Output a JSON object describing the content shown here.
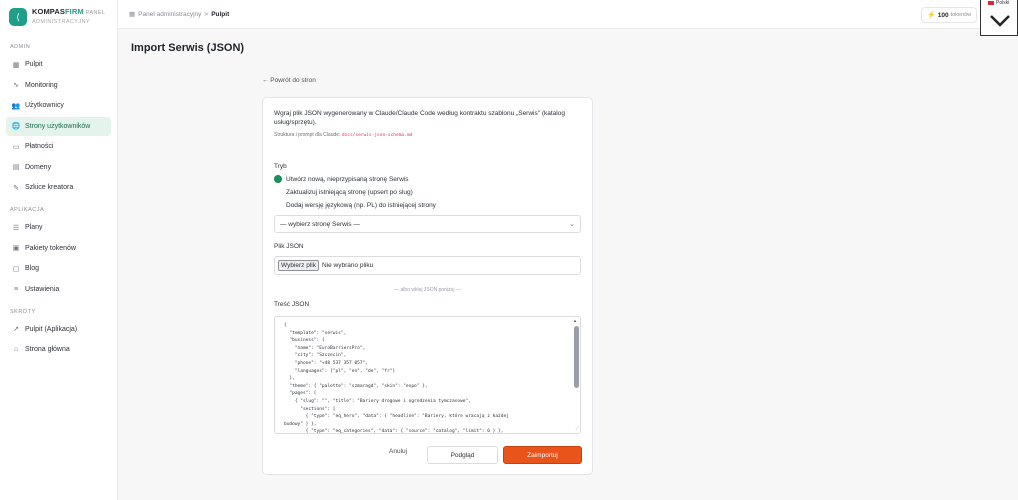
{
  "brand": {
    "name_part1": "KOMPAS",
    "name_part2": "FIRM",
    "panel_word": "PANEL",
    "subtitle": "ADMINISTRACYJNY",
    "logo_glyph": "⟨"
  },
  "sidebar": {
    "sections": [
      {
        "label": "ADMIN",
        "items": [
          {
            "label": "Pulpit",
            "icon": "dashboard-icon",
            "glyph": "▦"
          },
          {
            "label": "Monitoring",
            "icon": "activity-icon",
            "glyph": "∿"
          },
          {
            "label": "Użytkownicy",
            "icon": "users-icon",
            "glyph": "👥"
          },
          {
            "label": "Strony użytkowników",
            "icon": "globe-icon",
            "glyph": "🌐",
            "active": true
          },
          {
            "label": "Płatności",
            "icon": "card-icon",
            "glyph": "▭"
          },
          {
            "label": "Domeny",
            "icon": "server-icon",
            "glyph": "▤"
          },
          {
            "label": "Szkice kreatora",
            "icon": "edit-icon",
            "glyph": "✎"
          }
        ]
      },
      {
        "label": "APLIKACJA",
        "items": [
          {
            "label": "Plany",
            "icon": "list-icon",
            "glyph": "☰"
          },
          {
            "label": "Pakiety tokenów",
            "icon": "package-icon",
            "glyph": "▣"
          },
          {
            "label": "Blog",
            "icon": "document-icon",
            "glyph": "▢"
          },
          {
            "label": "Ustawienia",
            "icon": "settings-icon",
            "glyph": "≡"
          }
        ]
      },
      {
        "label": "SKRÓTY",
        "items": [
          {
            "label": "Pulpit (Aplikacja)",
            "icon": "external-link-icon",
            "glyph": "↗"
          },
          {
            "label": "Strona główna",
            "icon": "home-icon",
            "glyph": "⌂"
          }
        ]
      }
    ]
  },
  "topbar": {
    "breadcrumb_root": "Panel administracyjny",
    "breadcrumb_sep": ">",
    "breadcrumb_current": "Pulpit",
    "tokens_count": "100",
    "tokens_unit": "tokenów",
    "lang_label": "Polski"
  },
  "page": {
    "title": "Import Serwis (JSON)",
    "back_link": "← Powrót do stron"
  },
  "form": {
    "intro": "Wgraj plik JSON wygenerowany w Claude/Claude Code według kontraktu szablonu „Serwis\" (katalog usług/sprzętu).",
    "structure_label": "Struktura i prompt dla Claude:",
    "structure_path": "docs/serwis-json-schema.md",
    "mode_label": "Tryb",
    "modes": [
      {
        "label": "Utwórz nową, nieprzypisaną stronę Serwis",
        "checked": true
      },
      {
        "label": "Zaktualizuj istniejącą stronę (upsert po slug)",
        "checked": false
      },
      {
        "label": "Dodaj wersję językową (np. PL) do istniejącej strony",
        "checked": false
      }
    ],
    "select_value": "— wybierz stronę Serwis —",
    "file_label": "Plik JSON",
    "file_button": "Wybierz plik",
    "file_status": "Nie wybrano pliku",
    "divider": "— albo wklej JSON poniżej —",
    "content_label": "Treść JSON",
    "json_content": "{\n  \"template\": \"serwis\",\n  \"business\": {\n    \"name\": \"EuroBarriersPro\",\n    \"city\": \"Szczecin\",\n    \"phone\": \"+48 537 357 057\",\n    \"languages\": [\"pl\", \"en\", \"de\", \"fr\"]\n  },\n  \"theme\": { \"palette\": \"szmaragd\", \"skin\": \"expo\" },\n  \"pages\": [\n    { \"slug\": \"\", \"title\": \"Bariery drogowe i ogrodzenia tymczasowe\",\n      \"sections\": [\n        { \"type\": \"eq_hero\", \"data\": { \"headline\": \"Bariery, które wracają z każdej\nbudowy\" } },\n        { \"type\": \"eq_categories\", \"data\": { \"source\": \"catalog\", \"limit\": 6 } },",
    "cancel": "Anuluj",
    "preview": "Podgląd",
    "submit": "Zaimportuj"
  }
}
